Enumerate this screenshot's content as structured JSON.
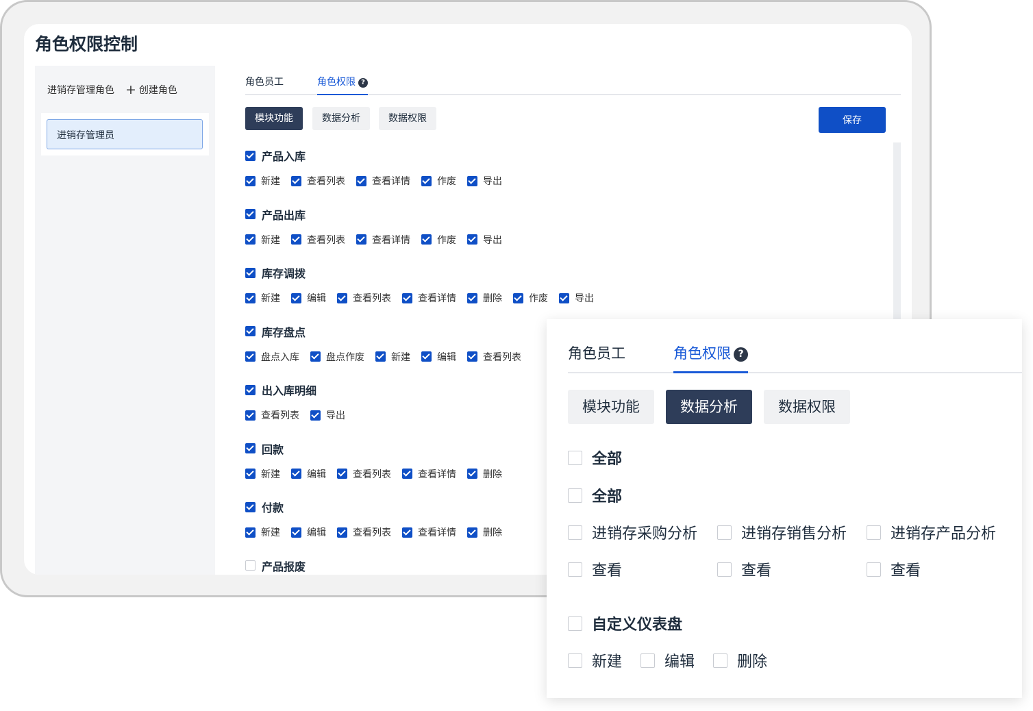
{
  "page_title": "角色权限控制",
  "sidebar": {
    "heading": "进销存管理角色",
    "create_label": "创建角色",
    "roles": [
      {
        "label": "进销存管理员",
        "selected": true
      }
    ]
  },
  "tabs": [
    {
      "label": "角色员工",
      "active": false
    },
    {
      "label": "角色权限",
      "active": true
    }
  ],
  "subtabs": [
    {
      "label": "模块功能",
      "active": true
    },
    {
      "label": "数据分析",
      "active": false
    },
    {
      "label": "数据权限",
      "active": false
    }
  ],
  "save_label": "保存",
  "colors": {
    "accent": "#0f4fc6",
    "active_tab": "#1a5ad7",
    "dark_button": "#2e3d59"
  },
  "groups": [
    {
      "title": "产品入库",
      "checked": true,
      "items": [
        {
          "label": "新建",
          "checked": true
        },
        {
          "label": "查看列表",
          "checked": true
        },
        {
          "label": "查看详情",
          "checked": true
        },
        {
          "label": "作废",
          "checked": true
        },
        {
          "label": "导出",
          "checked": true
        }
      ]
    },
    {
      "title": "产品出库",
      "checked": true,
      "items": [
        {
          "label": "新建",
          "checked": true
        },
        {
          "label": "查看列表",
          "checked": true
        },
        {
          "label": "查看详情",
          "checked": true
        },
        {
          "label": "作废",
          "checked": true
        },
        {
          "label": "导出",
          "checked": true
        }
      ]
    },
    {
      "title": "库存调拨",
      "checked": true,
      "items": [
        {
          "label": "新建",
          "checked": true
        },
        {
          "label": "编辑",
          "checked": true
        },
        {
          "label": "查看列表",
          "checked": true
        },
        {
          "label": "查看详情",
          "checked": true
        },
        {
          "label": "删除",
          "checked": true
        },
        {
          "label": "作废",
          "checked": true
        },
        {
          "label": "导出",
          "checked": true
        }
      ]
    },
    {
      "title": "库存盘点",
      "checked": true,
      "items": [
        {
          "label": "盘点入库",
          "checked": true
        },
        {
          "label": "盘点作废",
          "checked": true
        },
        {
          "label": "新建",
          "checked": true
        },
        {
          "label": "编辑",
          "checked": true
        },
        {
          "label": "查看列表",
          "checked": true
        }
      ]
    },
    {
      "title": "出入库明细",
      "checked": true,
      "items": [
        {
          "label": "查看列表",
          "checked": true
        },
        {
          "label": "导出",
          "checked": true
        }
      ]
    },
    {
      "title": "回款",
      "checked": true,
      "items": [
        {
          "label": "新建",
          "checked": true
        },
        {
          "label": "编辑",
          "checked": true
        },
        {
          "label": "查看列表",
          "checked": true
        },
        {
          "label": "查看详情",
          "checked": true
        },
        {
          "label": "删除",
          "checked": true
        }
      ]
    },
    {
      "title": "付款",
      "checked": true,
      "items": [
        {
          "label": "新建",
          "checked": true
        },
        {
          "label": "编辑",
          "checked": true
        },
        {
          "label": "查看列表",
          "checked": true
        },
        {
          "label": "查看详情",
          "checked": true
        },
        {
          "label": "删除",
          "checked": true
        }
      ]
    },
    {
      "title": "产品报废",
      "checked": false,
      "items": []
    }
  ],
  "overlay": {
    "tabs": [
      {
        "label": "角色员工"
      },
      {
        "label": "角色权限"
      }
    ],
    "subtabs": [
      {
        "label": "模块功能"
      },
      {
        "label": "数据分析"
      },
      {
        "label": "数据权限"
      }
    ],
    "all_1": "全部",
    "all_2": "全部",
    "analyses": [
      {
        "label": "进销存采购分析",
        "view": "查看"
      },
      {
        "label": "进销存销售分析",
        "view": "查看"
      },
      {
        "label": "进销存产品分析",
        "view": "查看"
      }
    ],
    "dashboard": {
      "title": "自定义仪表盘",
      "items": [
        "新建",
        "编辑",
        "删除"
      ]
    }
  }
}
